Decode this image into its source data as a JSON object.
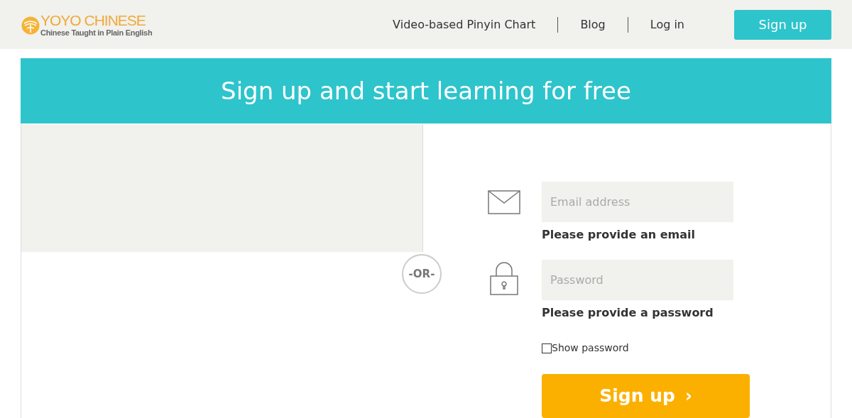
{
  "header": {
    "logo": {
      "name": "YOYO CHINESE",
      "tagline": "Chinese Taught in Plain English"
    },
    "nav": [
      {
        "label": "Video-based Pinyin Chart"
      },
      {
        "label": "Blog"
      },
      {
        "label": "Log in"
      }
    ],
    "signup_button": "Sign up"
  },
  "banner": {
    "title": "Sign up and start learning for free"
  },
  "divider": "-OR-",
  "form": {
    "email": {
      "placeholder": "Email address",
      "error": "Please provide an email"
    },
    "password": {
      "placeholder": "Password",
      "error": "Please provide a password"
    },
    "show_password": {
      "label": "Show password",
      "checked": false
    },
    "submit": {
      "label": "Sign up",
      "arrow": "›"
    }
  }
}
